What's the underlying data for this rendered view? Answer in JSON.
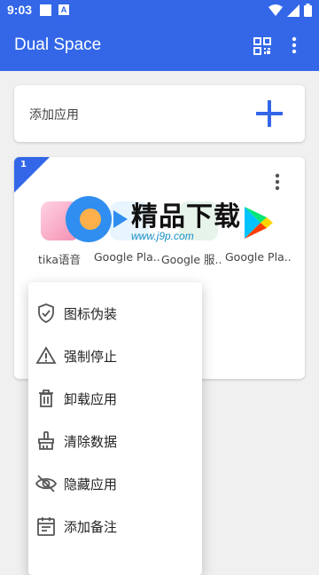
{
  "status_bar": {
    "time": "9:03",
    "a_icon_letter": "A"
  },
  "app_bar": {
    "title": "Dual Space"
  },
  "add_card": {
    "label": "添加应用"
  },
  "space_card": {
    "number": "1",
    "apps": [
      {
        "label": "tika语音",
        "color": "#f7a6c8"
      },
      {
        "label": "Google Pla..",
        "color": "#4fc3f7"
      },
      {
        "label": "Google 服..",
        "color": "#34a853"
      },
      {
        "label": "Google Pla..",
        "color": "#ea4335"
      }
    ]
  },
  "menu": {
    "items": [
      {
        "label": "图标伪装",
        "icon": "shield-check-icon"
      },
      {
        "label": "强制停止",
        "icon": "warning-icon"
      },
      {
        "label": "卸载应用",
        "icon": "trash-icon"
      },
      {
        "label": "清除数据",
        "icon": "broom-icon"
      },
      {
        "label": "隐藏应用",
        "icon": "eye-off-icon"
      },
      {
        "label": "添加备注",
        "icon": "calendar-note-icon"
      }
    ]
  },
  "watermark": {
    "text": "精品下载",
    "url": "www.j9p.com"
  },
  "colors": {
    "primary": "#3367e8",
    "icon_gray": "#555555"
  }
}
